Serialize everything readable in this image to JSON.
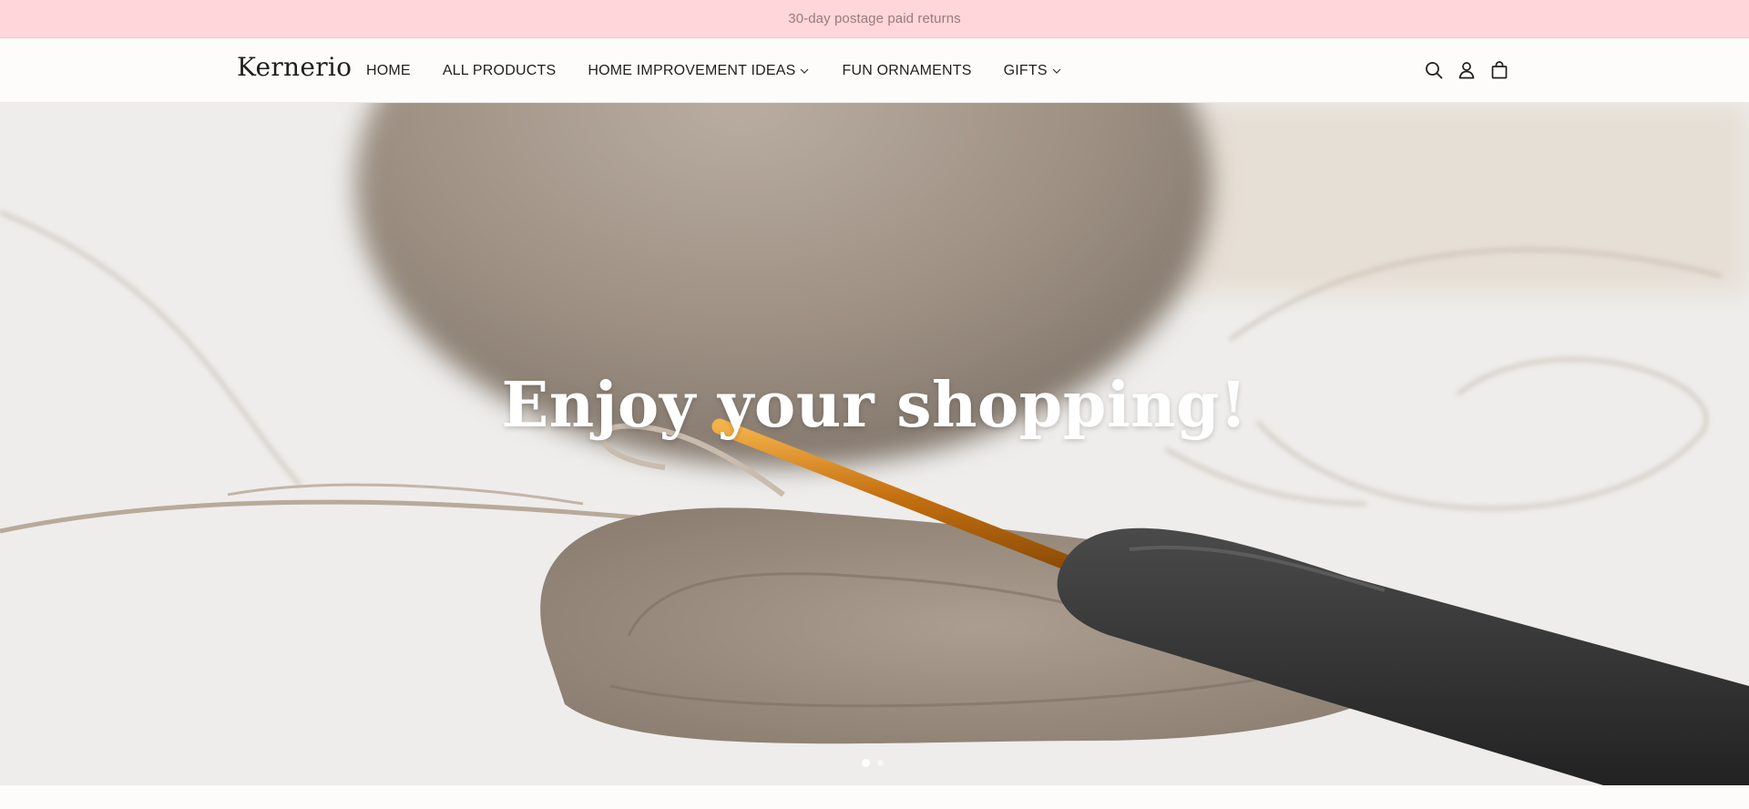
{
  "announcement": {
    "text": "30-day postage paid returns"
  },
  "header": {
    "logo": "Kernerio",
    "nav": [
      {
        "label": "HOME",
        "has_dropdown": false
      },
      {
        "label": "ALL PRODUCTS",
        "has_dropdown": false
      },
      {
        "label": "HOME IMPROVEMENT IDEAS",
        "has_dropdown": true
      },
      {
        "label": "FUN ORNAMENTS",
        "has_dropdown": false
      },
      {
        "label": "GIFTS",
        "has_dropdown": true
      }
    ],
    "icons": [
      "search-icon",
      "account-icon",
      "cart-icon"
    ]
  },
  "hero": {
    "title": "Enjoy your shopping!",
    "slides_total": 2,
    "active_slide": 1
  },
  "colors": {
    "announcement_bg": "#ffd6d9",
    "announcement_text": "#9a7a7c",
    "header_bg": "#fdfcfb",
    "text": "#1f1f1f",
    "hero_title": "#ffffff"
  }
}
